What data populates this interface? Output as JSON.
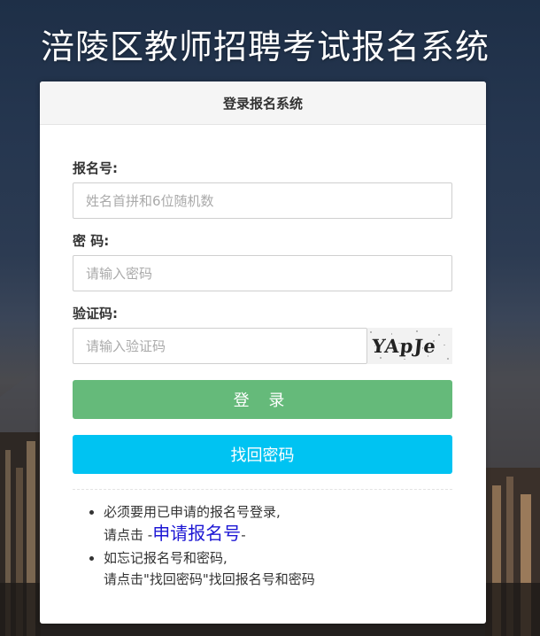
{
  "page": {
    "title": "涪陵区教师招聘考试报名系统"
  },
  "panel": {
    "title": "登录报名系统"
  },
  "form": {
    "reg_label": "报名号:",
    "reg_placeholder": "姓名首拼和6位随机数",
    "pwd_label": "密 码:",
    "pwd_placeholder": "请输入密码",
    "captcha_label": "验证码:",
    "captcha_placeholder": "请输入验证码",
    "captcha_text": "YApJe"
  },
  "buttons": {
    "login": "登 录",
    "find": "找回密码"
  },
  "notes": {
    "line1": "必须要用已申请的报名号登录,",
    "line2_prefix": "请点击 -",
    "link": "申请报名号",
    "line2_suffix": "-",
    "line3": "如忘记报名号和密码,",
    "line4": "请点击\"找回密码\"找回报名号和密码"
  },
  "colors": {
    "login_button": "#65ba7a",
    "find_button": "#00c3f2",
    "link": "#1d17d4"
  }
}
